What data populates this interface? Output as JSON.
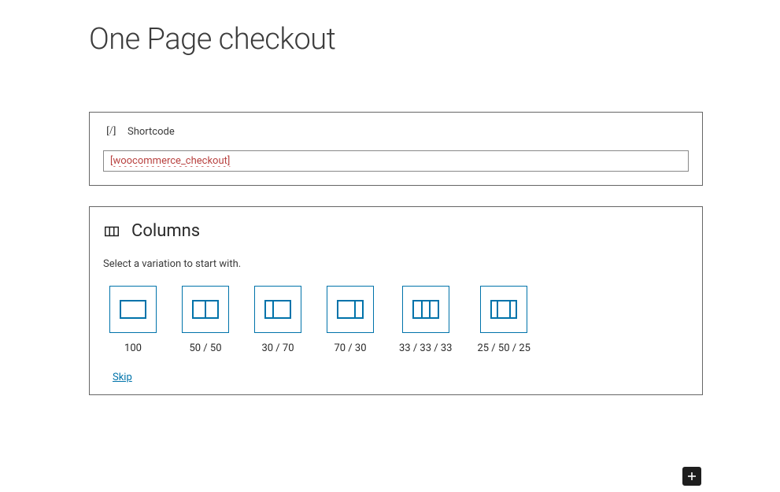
{
  "page": {
    "title": "One Page checkout"
  },
  "shortcode_block": {
    "label": "Shortcode",
    "icon_glyph": "[/]",
    "value": "[woocommerce_checkout]"
  },
  "columns_block": {
    "title": "Columns",
    "description": "Select a variation to start with.",
    "variations": [
      {
        "label": "100"
      },
      {
        "label": "50 / 50"
      },
      {
        "label": "30 / 70"
      },
      {
        "label": "70 / 30"
      },
      {
        "label": "33 / 33 / 33"
      },
      {
        "label": "25 / 50 / 25"
      }
    ],
    "skip_label": "Skip"
  },
  "colors": {
    "accent": "#0073aa"
  }
}
